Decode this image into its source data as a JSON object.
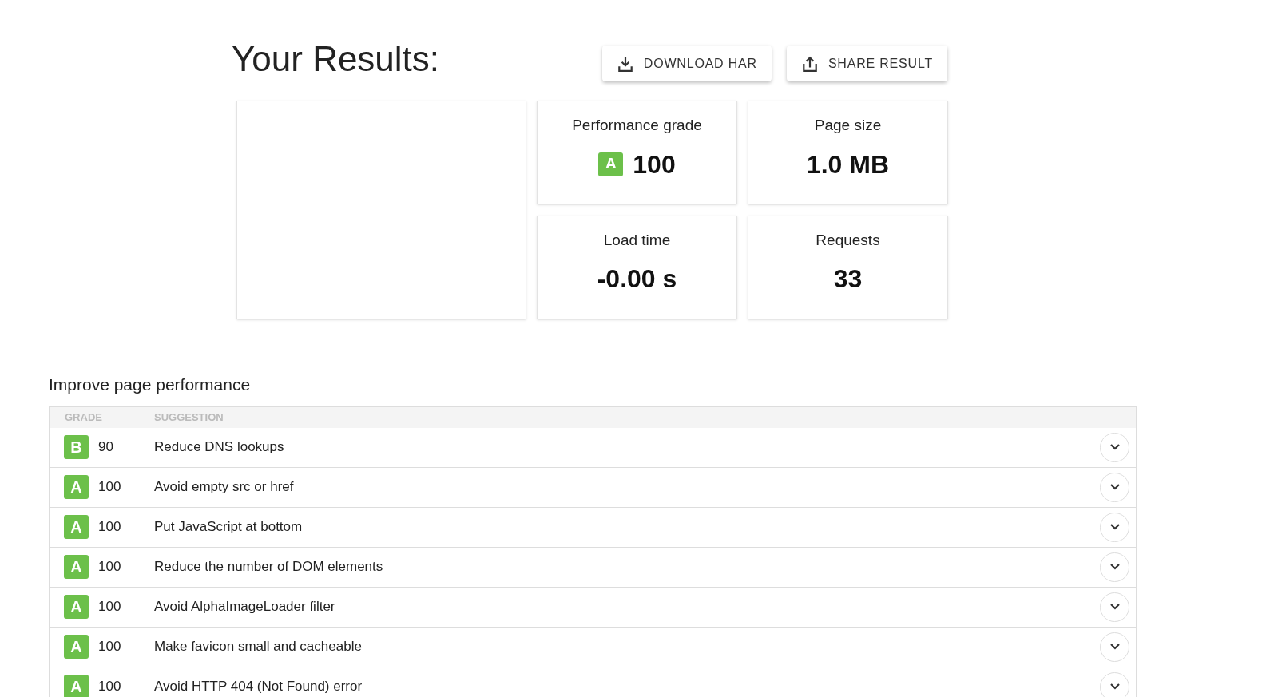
{
  "title": "Your Results:",
  "actions": [
    {
      "kind": "download",
      "label": "DOWNLOAD HAR"
    },
    {
      "kind": "share",
      "label": "SHARE RESULT"
    }
  ],
  "metrics": [
    {
      "label": "Performance grade",
      "grade": "A",
      "value": "100"
    },
    {
      "label": "Page size",
      "value": "1.0 MB"
    },
    {
      "label": "Load time",
      "value": "-0.00 s"
    },
    {
      "label": "Requests",
      "value": "33"
    }
  ],
  "section_title": "Improve page performance",
  "table": {
    "columns": [
      "GRADE",
      "SUGGESTION"
    ],
    "rows": [
      {
        "grade": "B",
        "score": "90",
        "suggestion": "Reduce DNS lookups",
        "expanded": false
      },
      {
        "grade": "A",
        "score": "100",
        "suggestion": "Avoid empty src or href",
        "expanded": false
      },
      {
        "grade": "A",
        "score": "100",
        "suggestion": "Put JavaScript at bottom",
        "expanded": false
      },
      {
        "grade": "A",
        "score": "100",
        "suggestion": "Reduce the number of DOM elements",
        "expanded": false
      },
      {
        "grade": "A",
        "score": "100",
        "suggestion": "Avoid AlphaImageLoader filter",
        "expanded": false
      },
      {
        "grade": "A",
        "score": "100",
        "suggestion": "Make favicon small and cacheable",
        "expanded": false
      },
      {
        "grade": "A",
        "score": "100",
        "suggestion": "Avoid HTTP 404 (Not Found) error",
        "expanded": false
      }
    ]
  }
}
